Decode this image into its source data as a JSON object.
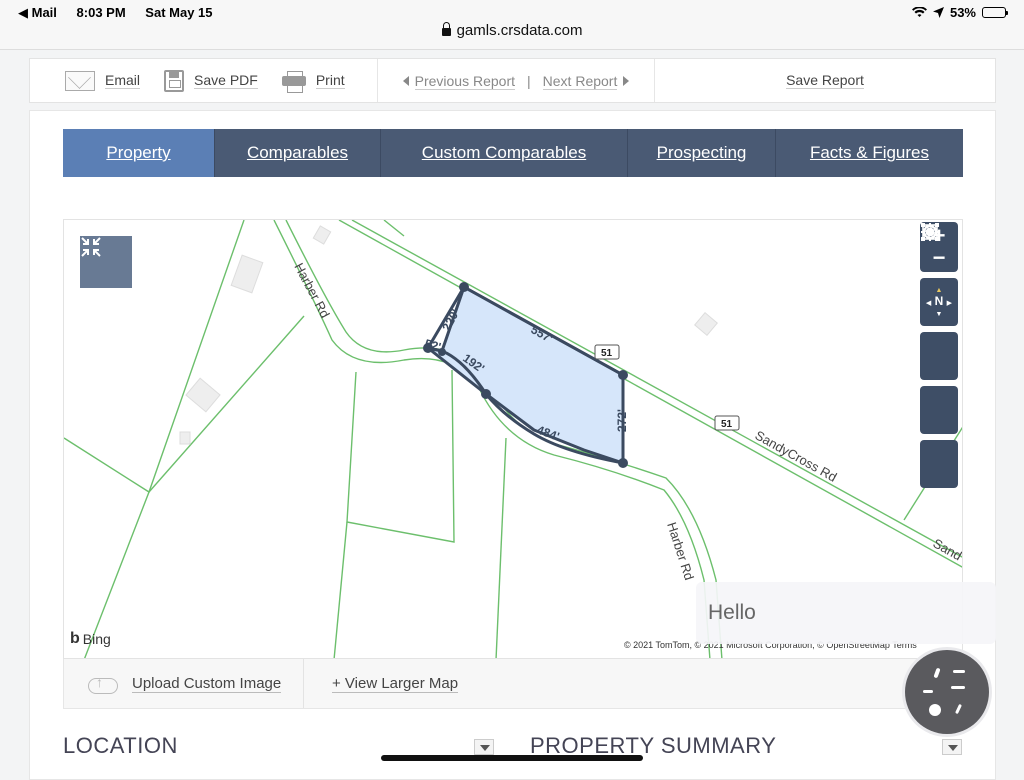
{
  "status": {
    "back_app": "◀ Mail",
    "time": "8:03 PM",
    "date": "Sat May 15",
    "battery": "53%",
    "battery_level": 0.53
  },
  "url": "gamls.crsdata.com",
  "toolbar": {
    "email": "Email",
    "save_pdf": "Save PDF",
    "print": "Print",
    "previous": "Previous Report",
    "separator": "|",
    "next": "Next Report",
    "save_report": "Save Report"
  },
  "tabs": [
    {
      "label": "Property",
      "active": true
    },
    {
      "label": "Comparables",
      "active": false
    },
    {
      "label": "Custom Comparables",
      "active": false
    },
    {
      "label": "Prospecting",
      "active": false
    },
    {
      "label": "Facts & Figures",
      "active": false
    }
  ],
  "map": {
    "roads": {
      "harber_upper": "Harber Rd",
      "harber_lower": "Harber Rd",
      "sandycross": "SandyCross Rd",
      "sandy_partial": "Sand"
    },
    "route_shields": [
      "51",
      "51"
    ],
    "dimensions": [
      "220'",
      "557'",
      "52'",
      "192'",
      "272'",
      "484'"
    ],
    "controls": {
      "zoom_in": "+",
      "zoom_out": "−",
      "north": "N"
    },
    "provider": "Bing",
    "attribution": "© 2021 TomTom, © 2021 Microsoft Corporation, © OpenStreetMap Terms"
  },
  "map_footer": {
    "upload": "Upload Custom Image",
    "view_larger": "+ View Larger Map"
  },
  "sections": {
    "location": "LOCATION",
    "property_summary": "PROPERTY SUMMARY"
  },
  "overlay": {
    "hello": "Hello"
  },
  "colors": {
    "tab_bg": "#4a5a74",
    "tab_active": "#5b7fb5",
    "parcel_fill": "#d6e6fa",
    "parcel_stroke": "#3b4a60",
    "parcel_lines": "#6cbf6c"
  }
}
